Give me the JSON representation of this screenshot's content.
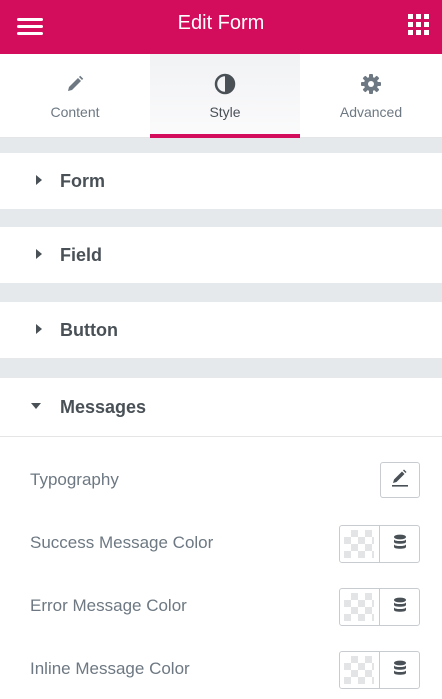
{
  "header": {
    "title": "Edit Form",
    "menu_icon": "hamburger-menu-icon",
    "apps_icon": "grid-apps-icon",
    "background_color": "#d30c5c"
  },
  "tabs": [
    {
      "label": "Content",
      "icon": "pencil-icon",
      "active": false
    },
    {
      "label": "Style",
      "icon": "half-circle-contrast-icon",
      "active": true
    },
    {
      "label": "Advanced",
      "icon": "gear-icon",
      "active": false
    }
  ],
  "sections": [
    {
      "title": "Form",
      "expanded": false
    },
    {
      "title": "Field",
      "expanded": false
    },
    {
      "title": "Button",
      "expanded": false
    },
    {
      "title": "Messages",
      "expanded": true
    }
  ],
  "messages_controls": {
    "typography": {
      "label": "Typography",
      "icon": "pencil-icon"
    },
    "colors": [
      {
        "label": "Success Message Color",
        "icon": "database-globals-icon"
      },
      {
        "label": "Error Message Color",
        "icon": "database-globals-icon"
      },
      {
        "label": "Inline Message Color",
        "icon": "database-globals-icon"
      }
    ]
  },
  "colors": {
    "accent": "#d30c5c",
    "heading_text": "#495157",
    "label_text": "#6d7882",
    "separator": "#e6e9ec"
  }
}
